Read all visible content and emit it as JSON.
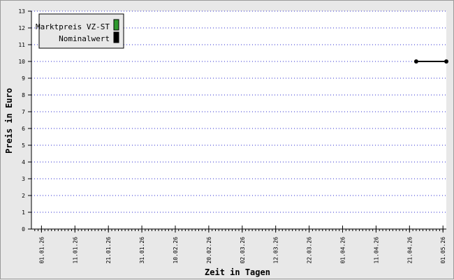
{
  "chart_data": {
    "type": "line",
    "title": "",
    "xlabel": "Zeit in Tagen",
    "ylabel": "Preis in Euro",
    "ylim": [
      0,
      13
    ],
    "yticks": [
      0,
      1,
      2,
      3,
      4,
      5,
      6,
      7,
      8,
      9,
      10,
      11,
      12,
      13
    ],
    "xlim": [
      "2025-12-29",
      "2026-05-02"
    ],
    "xticks": [
      "2026-01-01",
      "2026-01-11",
      "2026-01-21",
      "2026-01-31",
      "2026-02-10",
      "2026-02-20",
      "2026-03-02",
      "2026-03-12",
      "2026-03-22",
      "2026-04-01",
      "2026-04-11",
      "2026-04-21",
      "2026-05-01"
    ],
    "xtick_labels": [
      "01.01.26",
      "11.01.26",
      "21.01.26",
      "31.01.26",
      "10.02.26",
      "20.02.26",
      "02.03.26",
      "12.03.26",
      "22.03.26",
      "01.04.26",
      "11.04.26",
      "21.04.26",
      "01.05.26"
    ],
    "grid": true,
    "legend_position": "top-left",
    "series": [
      {
        "name": "Marktpreis VZ-ST",
        "color": "#2e9a2e",
        "points": []
      },
      {
        "name": "Nominalwert",
        "color": "#000000",
        "points": [
          {
            "x": "2026-04-23",
            "y": 10
          },
          {
            "x": "2026-05-02",
            "y": 10
          }
        ]
      }
    ]
  }
}
